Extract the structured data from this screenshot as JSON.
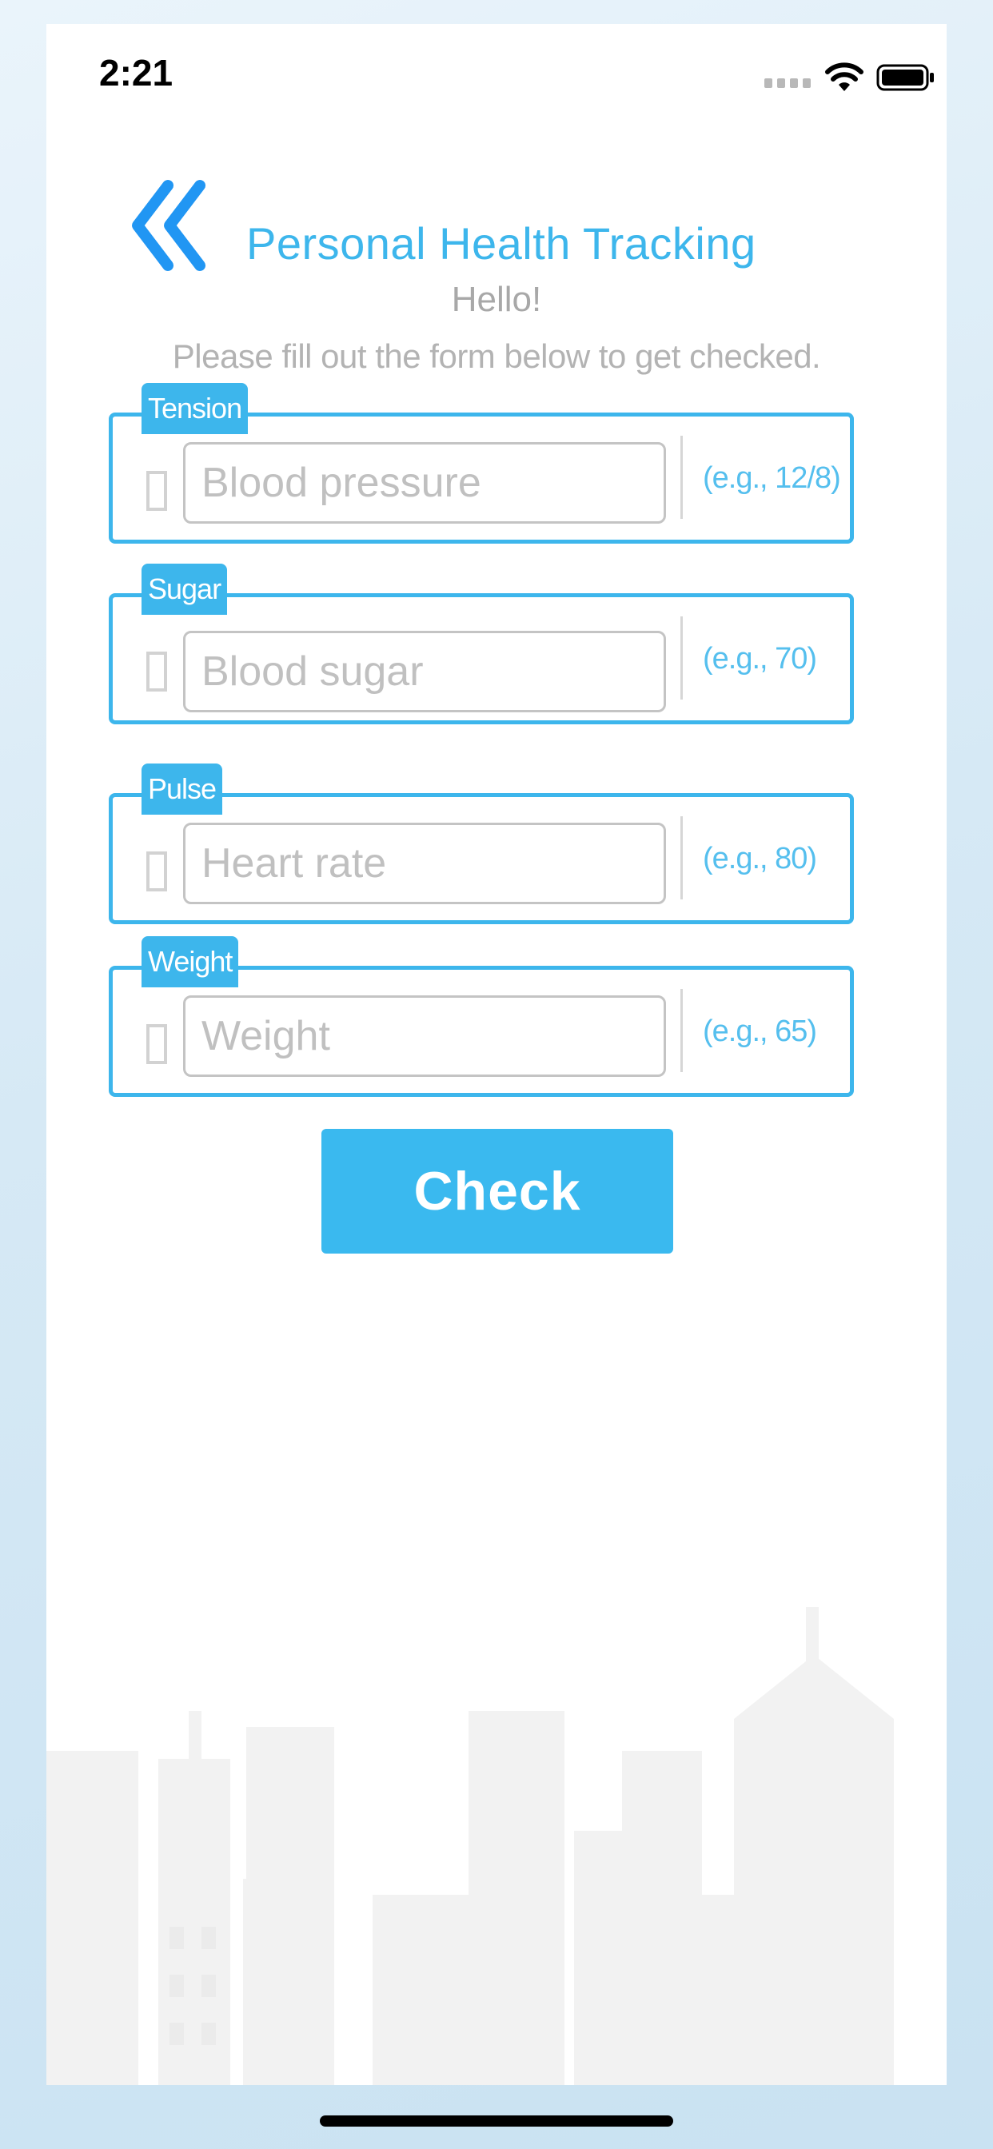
{
  "status_bar": {
    "time": "2:21"
  },
  "header": {
    "title": "Personal Health Tracking",
    "greeting": "Hello!",
    "instruction": "Please fill out the form below to get checked."
  },
  "form": {
    "fields": [
      {
        "tag": "Tension",
        "placeholder": "Blood pressure",
        "hint": "(e.g., 12/8)"
      },
      {
        "tag": "Sugar",
        "placeholder": "Blood sugar",
        "hint": "(e.g., 70)"
      },
      {
        "tag": "Pulse",
        "placeholder": "Heart rate",
        "hint": "(e.g., 80)"
      },
      {
        "tag": "Weight",
        "placeholder": "Weight",
        "hint": "(e.g., 65)"
      }
    ],
    "submit_label": "Check"
  },
  "colors": {
    "accent": "#3db6ec",
    "back_icon": "#2196f3",
    "button": "#3ab9ef"
  },
  "icons": {
    "back": "double-chevron-left-icon",
    "wifi": "wifi-icon",
    "battery": "battery-icon"
  }
}
